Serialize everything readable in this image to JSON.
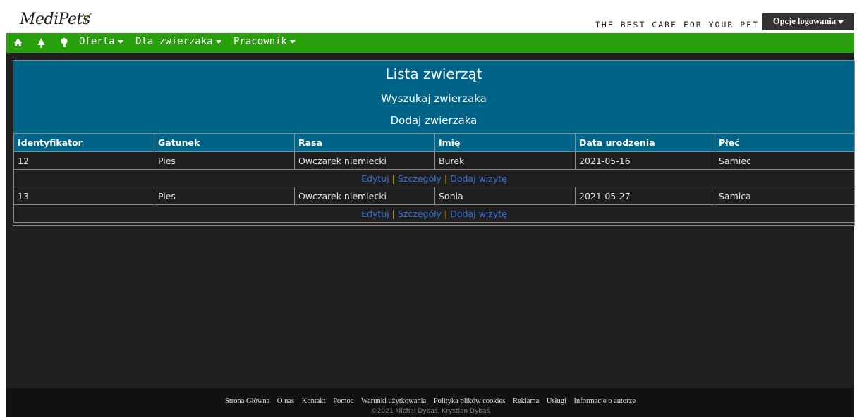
{
  "header": {
    "logo_text": "MediPets",
    "tagline": "THE BEST CARE FOR YOUR PET",
    "login_label": "Opcje logowania"
  },
  "nav": {
    "icons": [
      "home-icon",
      "tree-icon",
      "bulb-icon"
    ],
    "menus": [
      "Oferta",
      "Dla zwierzaka",
      "Pracownik"
    ]
  },
  "panel": {
    "title": "Lista zwierząt",
    "search_link": "Wyszukaj zwierzaka",
    "add_link": "Dodaj zwierzaka"
  },
  "table": {
    "headers": [
      "Identyfikator",
      "Gatunek",
      "Rasa",
      "Imię",
      "Data urodzenia",
      "Płeć"
    ],
    "rows": [
      {
        "cells": [
          "12",
          "Pies",
          "Owczarek niemiecki",
          "Burek",
          "2021-05-16",
          "Samiec"
        ],
        "actions": [
          "Edytuj",
          "Szczegóły",
          "Dodaj wizytę"
        ]
      },
      {
        "cells": [
          "13",
          "Pies",
          "Owczarek niemiecki",
          "Sonia",
          "2021-05-27",
          "Samica"
        ],
        "actions": [
          "Edytuj",
          "Szczegóły",
          "Dodaj wizytę"
        ]
      }
    ]
  },
  "footer": {
    "links": [
      "Strona Główna",
      "O nas",
      "Kontakt",
      "Pomoc",
      "Warunki użytkowania",
      "Polityka plików cookies",
      "Reklama",
      "Usługi",
      "Informacje o autorze"
    ],
    "copyright": "©2021 Michał Dybaś, Krystian Dybaś"
  },
  "colors": {
    "nav_green": "#27a00c",
    "panel_blue": "#006488",
    "background_dark": "#202020",
    "link_blue": "#3a6fd6"
  }
}
